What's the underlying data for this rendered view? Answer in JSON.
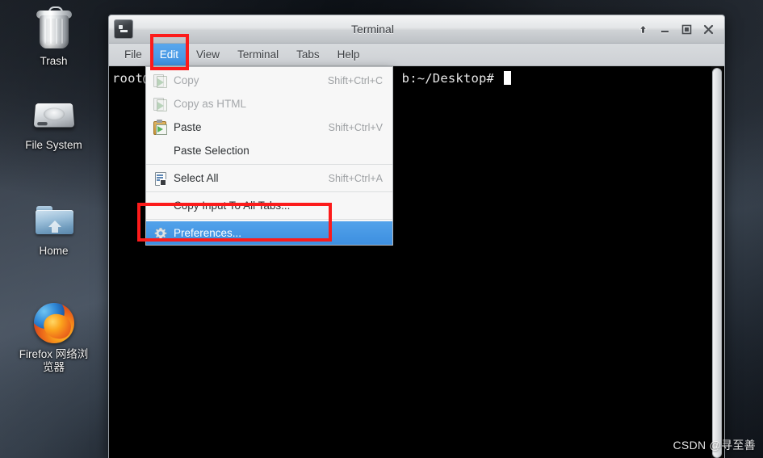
{
  "desktop": {
    "icons": [
      {
        "name": "trash",
        "label": "Trash",
        "icon": "trash-icon"
      },
      {
        "name": "file-system",
        "label": "File System",
        "icon": "harddisk-icon"
      },
      {
        "name": "home",
        "label": "Home",
        "icon": "folder-home-icon"
      },
      {
        "name": "firefox",
        "label": "Firefox 网络浏览器",
        "label_line1": "Firefox 网络浏",
        "label_line2": "览器",
        "icon": "firefox-icon"
      }
    ]
  },
  "terminal": {
    "title": "Terminal",
    "window_icon": "terminal-icon",
    "window_buttons": [
      {
        "name": "shade-button",
        "icon": "arrow-up-icon",
        "glyph": "⇧"
      },
      {
        "name": "minimize-button",
        "icon": "minimize-icon",
        "glyph": "–"
      },
      {
        "name": "maximize-button",
        "icon": "maximize-icon",
        "glyph": "□"
      },
      {
        "name": "close-button",
        "icon": "close-icon",
        "glyph": "✕"
      }
    ],
    "menubar": [
      {
        "name": "file",
        "label": "File",
        "active": false
      },
      {
        "name": "edit",
        "label": "Edit",
        "active": true
      },
      {
        "name": "view",
        "label": "View",
        "active": false
      },
      {
        "name": "terminal",
        "label": "Terminal",
        "active": false
      },
      {
        "name": "tabs",
        "label": "Tabs",
        "active": false
      },
      {
        "name": "help",
        "label": "Help",
        "active": false
      }
    ],
    "prompt_prefix": "root@",
    "prompt_suffix": "b:~/Desktop# ",
    "scrollbar": {
      "name": "terminal-scrollbar"
    }
  },
  "edit_menu": {
    "items": [
      {
        "name": "copy",
        "label": "Copy",
        "accel": "Shift+Ctrl+C",
        "icon": "copy-icon",
        "state": "disabled"
      },
      {
        "name": "copy-as-html",
        "label": "Copy as HTML",
        "accel": "",
        "icon": "copy-icon",
        "state": "disabled"
      },
      {
        "name": "paste",
        "label": "Paste",
        "accel": "Shift+Ctrl+V",
        "icon": "paste-icon",
        "state": "normal"
      },
      {
        "name": "paste-selection",
        "label": "Paste Selection",
        "accel": "",
        "icon": "none",
        "state": "normal"
      },
      {
        "name": "select-all",
        "label": "Select All",
        "accel": "Shift+Ctrl+A",
        "icon": "select-all-icon",
        "state": "normal"
      },
      {
        "name": "copy-input-to-all-tabs",
        "label": "Copy Input To All Tabs...",
        "accel": "",
        "icon": "none",
        "state": "normal"
      },
      {
        "name": "preferences",
        "label": "Preferences...",
        "accel": "",
        "icon": "gear-icon",
        "state": "selected"
      }
    ]
  },
  "annotations": {
    "highlight_color": "#fc1b1b",
    "boxes": [
      {
        "name": "edit-menu-highlight",
        "target": "Edit"
      },
      {
        "name": "preferences-highlight",
        "target": "Preferences..."
      }
    ]
  },
  "watermark": {
    "text": "CSDN @寻至善"
  }
}
